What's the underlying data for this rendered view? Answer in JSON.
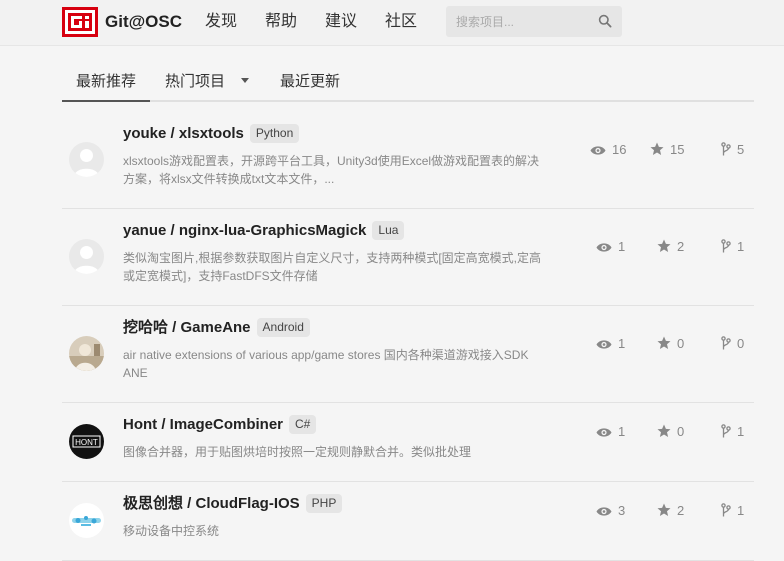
{
  "header": {
    "brand": "Git@OSC",
    "nav": [
      "发现",
      "帮助",
      "建议",
      "社区"
    ],
    "search_placeholder": "搜索项目..."
  },
  "tabs": [
    {
      "label": "最新推荐",
      "active": true
    },
    {
      "label": "热门项目",
      "dropdown": true
    },
    {
      "label": "最近更新"
    }
  ],
  "projects": [
    {
      "title": "youke / xlsxtools",
      "lang": "Python",
      "desc1": "xlsxtools游戏配置表，开源跨平台工具，Unity3d使用Excel做游戏配置表的解决",
      "desc2": "方案，将xlsx文件转换成txt文本文件，...",
      "views": "16",
      "stars": "15",
      "forks": "5"
    },
    {
      "title": "yanue / nginx-lua-GraphicsMagick",
      "lang": "Lua",
      "desc1": "类似淘宝图片,根据参数获取图片自定义尺寸，支持两种模式[固定高宽模式,定高",
      "desc2": "或定宽模式]，支持FastDFS文件存储",
      "views": "1",
      "stars": "2",
      "forks": "1"
    },
    {
      "title": "挖哈哈 / GameAne",
      "lang": "Android",
      "desc1": "air native extensions of various app/game stores 国内各种渠道游戏接入SDK",
      "desc2": "ANE",
      "views": "1",
      "stars": "0",
      "forks": "0"
    },
    {
      "title": "Hont / ImageCombiner",
      "lang": "C#",
      "avatar_text": "HONT",
      "desc1": "图像合并器，用于贴图烘培时按照一定规则静默合并。类似批处理",
      "desc2": "",
      "views": "1",
      "stars": "0",
      "forks": "1"
    },
    {
      "title": "极思创想 / CloudFlag-IOS",
      "lang": "PHP",
      "desc1": "移动设备中控系统",
      "desc2": "",
      "views": "3",
      "stars": "2",
      "forks": "1"
    }
  ],
  "colors": {
    "logo_red": "#d7000f",
    "accent_gray": "#888888"
  },
  "icons": {
    "views": "eye-icon",
    "stars": "star-icon",
    "forks": "fork-icon",
    "search": "search-icon"
  }
}
